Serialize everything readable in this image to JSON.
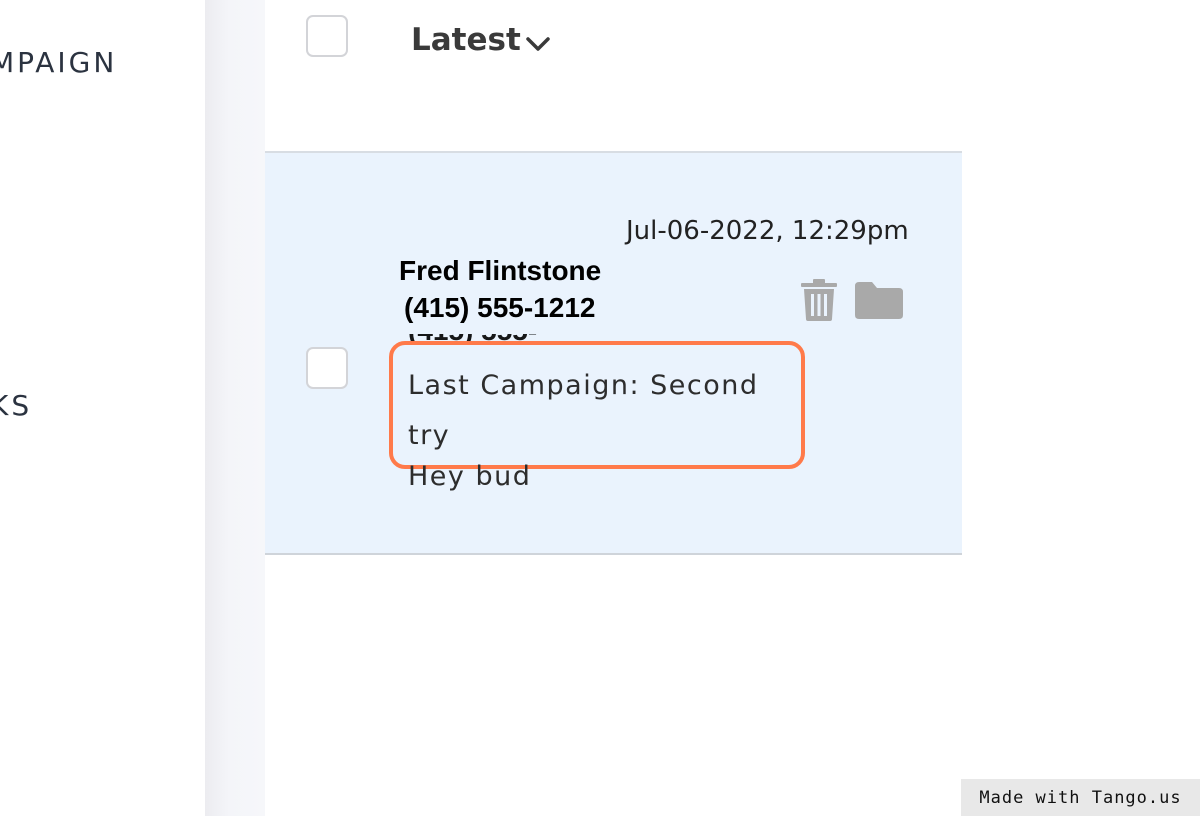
{
  "sidebar": {
    "items": [
      {
        "label": "MPAIGN"
      },
      {
        "label": "KS"
      }
    ]
  },
  "list_header": {
    "sort_label": "Latest",
    "sort_icon": "chevron-down-icon"
  },
  "conversation": {
    "timestamp": "Jul-06-2022, 12:29pm",
    "contact_name": "Fred Flintstone",
    "contact_phone": "(415) 555-1212",
    "hidden_phone": "(415) 555-1212",
    "last_campaign": "Last Campaign: Second try",
    "message_preview": "Hey bud",
    "actions": [
      "trash-icon",
      "folder-icon"
    ]
  },
  "colors": {
    "highlight": "#ff7a4a",
    "row_background": "#eaf3fd",
    "icon_gray": "#a9a9a9"
  },
  "watermark": "Made with Tango.us"
}
